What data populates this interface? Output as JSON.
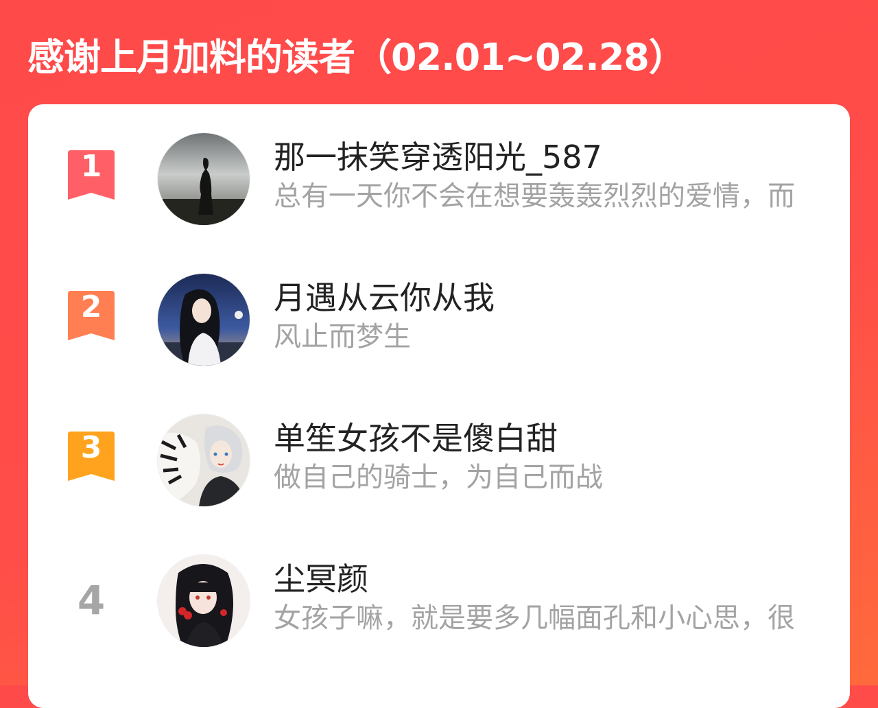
{
  "header": {
    "title": "感谢上月加料的读者（02.01~02.28）"
  },
  "colors": {
    "background": "#ff4a4a",
    "card": "#ffffff",
    "rank1": "#ff5a5f",
    "rank2": "#ff7a4f",
    "rank3": "#ffa61e",
    "name": "#222222",
    "quote": "#a3a3a3"
  },
  "readers": [
    {
      "rank": "1",
      "name": "那一抹笑穿透阳光_587",
      "quote": "总有一天你不会在想要轰轰烈烈的爱情，而",
      "avatar_icon": "silhouette-by-sea-avatar"
    },
    {
      "rank": "2",
      "name": "月遇从云你从我",
      "quote": "风止而梦生",
      "avatar_icon": "anime-girl-night-avatar"
    },
    {
      "rank": "3",
      "name": "单笙女孩不是傻白甜",
      "quote": "做自己的骑士，为自己而战",
      "avatar_icon": "tiger-and-boy-avatar"
    },
    {
      "rank": "4",
      "name": "尘冥颜",
      "quote": "女孩子嘛，就是要多几幅面孔和小心思，很",
      "avatar_icon": "girl-with-cherries-avatar"
    }
  ]
}
